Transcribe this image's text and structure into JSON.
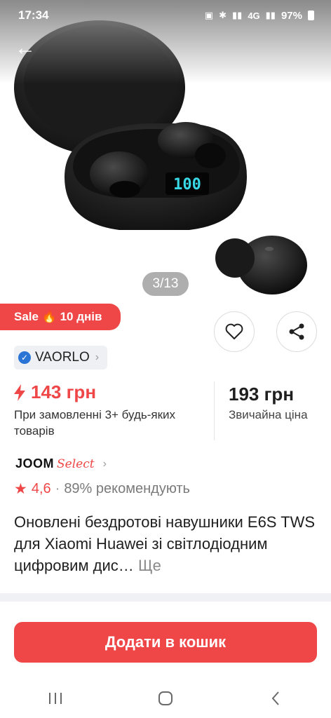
{
  "status_bar": {
    "time": "17:34",
    "battery_pct": "97%",
    "signal_label": "4G"
  },
  "gallery": {
    "counter": "3/13"
  },
  "sale": {
    "label": "Sale 🔥 10 днів"
  },
  "seller": {
    "name": "VAORLO"
  },
  "price": {
    "main": "143 грн",
    "main_note": "При замовленні 3+ будь-яких товарів",
    "regular": "193 грн",
    "regular_note": "Звичайна ціна"
  },
  "joom": {
    "brand": "JOOM",
    "select": "Select"
  },
  "rating": {
    "value": "4,6",
    "separator": "·",
    "recommend": "89% рекомендують"
  },
  "product": {
    "title": "Оновлені бездротові навушники E6S TWS для Xiaomi Huawei зі світлодіодним цифровим дис…",
    "more": "Ще"
  },
  "cart": {
    "label": "Додати в кошик"
  },
  "colors": {
    "accent": "#ef4747",
    "verified": "#2a74d6"
  }
}
